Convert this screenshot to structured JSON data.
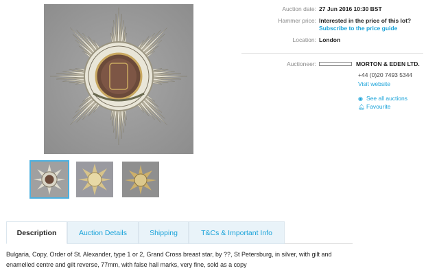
{
  "images": {
    "main_alt": "Order of St. Alexander Grand Cross breast star",
    "thumbnails": [
      "front view",
      "reverse view",
      "reverse angled view"
    ]
  },
  "details": {
    "auction_date_label": "Auction date:",
    "auction_date_value": "27 Jun 2016 10:30 BST",
    "hammer_price_label": "Hammer price:",
    "hammer_price_value": "Interested in the price of this lot?",
    "hammer_price_link": "Subscribe to the price guide",
    "location_label": "Location:",
    "location_value": "London",
    "auctioneer_label": "Auctioneer:",
    "auctioneer_name": "MORTON & EDEN LTD.",
    "phone": "+44 (0)20 7493 5344",
    "website_link": "Visit website",
    "see_all_link": "See all auctions",
    "favourite_link": "Favourite"
  },
  "icons": {
    "see_all": "eye-icon",
    "favourite": "bell-icon"
  },
  "tabs": [
    {
      "label": "Description",
      "active": true
    },
    {
      "label": "Auction Details",
      "active": false
    },
    {
      "label": "Shipping",
      "active": false
    },
    {
      "label": "T&Cs & Important Info",
      "active": false
    }
  ],
  "description": "Bulgaria, Copy, Order of St. Alexander, type 1 or 2, Grand Cross breast star, by ??, St Petersburg, in silver, with gilt and enamelled centre and gilt reverse, 77mm, with false hall marks, very fine, sold as a copy",
  "colors": {
    "accent": "#1aa3d9",
    "tab_bg": "#e9f3f9",
    "label_gray": "#8a8a8a"
  }
}
